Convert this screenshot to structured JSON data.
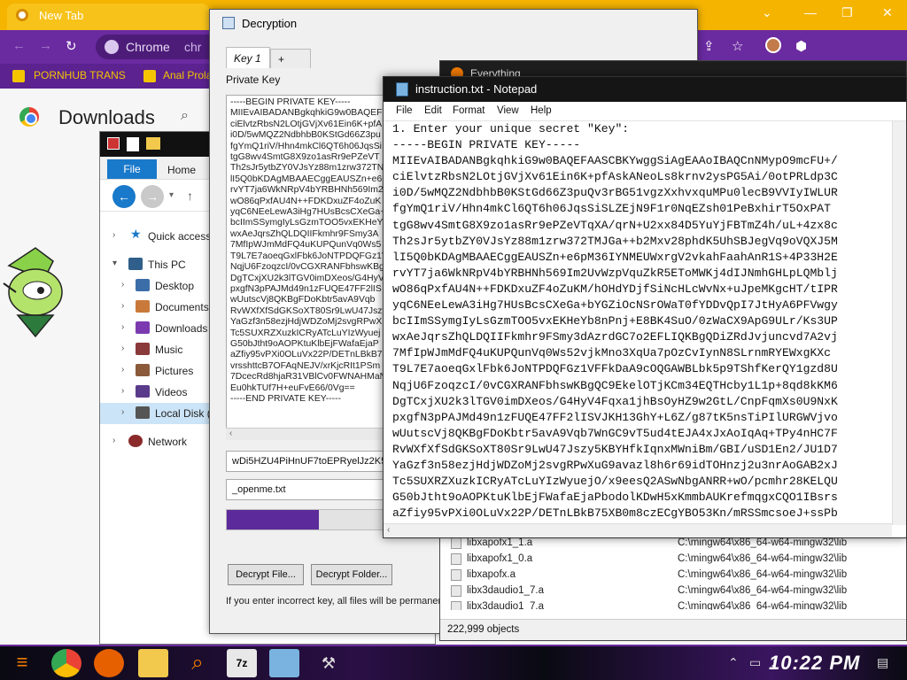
{
  "chrome": {
    "tab_title": "New Tab",
    "omnibox_text": "Chrome",
    "omnibox_suffix": "chr",
    "bookmarks": [
      "PORNHUB TRANS",
      "Anal Prola"
    ],
    "page_title": "Downloads"
  },
  "explorer": {
    "ribbon": {
      "file": "File",
      "home": "Home"
    },
    "tree": [
      {
        "label": "Quick access",
        "icon": "star-icon"
      },
      {
        "label": "This PC",
        "icon": "computer-icon"
      },
      {
        "label": "Desktop",
        "icon": "folder-icon"
      },
      {
        "label": "Documents",
        "icon": "folder-icon"
      },
      {
        "label": "Downloads",
        "icon": "download-folder-icon"
      },
      {
        "label": "Music",
        "icon": "music-folder-icon"
      },
      {
        "label": "Pictures",
        "icon": "pictures-folder-icon"
      },
      {
        "label": "Videos",
        "icon": "videos-folder-icon"
      },
      {
        "label": "Local Disk (",
        "icon": "disk-icon"
      },
      {
        "label": "Network",
        "icon": "network-icon"
      }
    ]
  },
  "decryption": {
    "title": "Decryption",
    "tabs": [
      "Key 1",
      "+"
    ],
    "private_key_label": "Private Key",
    "key_text_lines": [
      "-----BEGIN PRIVATE KEY-----",
      "MIIEvAIBADANBgkqhkiG9w0BAQEF",
      "ciElvtzRbsN2LOtjGVjXv61Ein6K+pfA",
      "i0D/5wMQZ2NdbhbB0KStGd66Z3pu",
      "fgYmQ1riV/Hhn4mkCl6QT6h06JqsSi",
      "tgG8wv4SmtG8X9zo1asRr9ePZeVT",
      "Th2sJr5ytbZY0VJsYz88m1zrw372TN",
      "lI5Q0bKDAgMBAAECggEAUSZn+e6p",
      "rvYT7ja6WkNRpV4bYRBHNh569Im2",
      "wO86qPxfAU4N++FDKDxuZF4oZuK",
      "yqC6NEeLewA3iHg7HUsBcsCXeGa+",
      "bcIImSSymgIyLsGzmTOO5vxEKHeY",
      "wxAeJqrsZhQLDQIIFkmhr9FSmy3A",
      "7MfIpWJmMdFQ4uKUPQunVq0Ws5",
      "T9L7E7aoeqGxlFbk6JoNTPDQFGz1V",
      "NqjU6FzoqzcI/0vCGXRANFbhswKBg",
      "DgTCxjXU2k3lTGV0imDXeos/G4HyV",
      "pxgfN3pPAJMd49n1zFUQE47FF2lIS",
      "wUutscVj8QKBgFDoKbtr5avA9Vqb",
      "RvWXfXfSdGKSoXT80Sr9LwU47Jszy",
      "YaGzf3n58ezjHdjWDZoMj2svgRPwX",
      "Tc5SUXRZXuzkICRyATcLuYIzWyuej",
      "G50bJtht9oAOPKtuKlbEjFWafaEjaP",
      "aZfiy95vPXi0OLuVx22P/DETnLBkB75",
      "vrsshttcB7OFAqNEJV/xrKjcRIt1PSm",
      "7DcecRd8hjaR31VBlCv0FWNAHMaN",
      "Eu0hkTUf7H+euFvE66/0Vg==",
      "-----END PRIVATE KEY-----"
    ],
    "key_input_value": "wDi5HZU4PiHnUF7toEPRyelJz2K5gq",
    "extension_input_value": "_openme.txt",
    "progress_fraction": 0.5,
    "btn_decrypt_file": "Decrypt File...",
    "btn_decrypt_folder": "Decrypt Folder...",
    "warning": "If you enter incorrect key, all files will be permaner"
  },
  "filewin": {
    "title": "Everything",
    "rows": [
      {
        "name": "libxapofx1_1.a",
        "path": "C:\\mingw64\\x86_64-w64-mingw32\\lib"
      },
      {
        "name": "libxapofx1_0.a",
        "path": "C:\\mingw64\\x86_64-w64-mingw32\\lib"
      },
      {
        "name": "libxapofx.a",
        "path": "C:\\mingw64\\x86_64-w64-mingw32\\lib"
      },
      {
        "name": "libx3daudio1_7.a",
        "path": "C:\\mingw64\\x86_64-w64-mingw32\\lib"
      },
      {
        "name": "libx3daudio1_7.a",
        "path": "C:\\mingw64\\x86_64-w64-mingw32\\lib"
      }
    ],
    "status": "222,999 objects"
  },
  "notepad": {
    "title": "instruction.txt - Notepad",
    "menu": [
      "File",
      "Edit",
      "Format",
      "View",
      "Help"
    ],
    "lines": [
      "1. Enter your unique secret \"Key\":",
      "-----BEGIN PRIVATE KEY-----",
      "MIIEvAIBADANBgkqhkiG9w0BAQEFAASCBKYwggSiAgEAAoIBAQCnNMypO9mcFU+/",
      "ciElvtzRbsN2LOtjGVjXv61Ein6K+pfAskANeoLs8krnv2ysPG5Ai/0otPRLdp3C",
      "i0D/5wMQZ2NdbhbB0KStGd66Z3puQv3rBG51vgzXxhvxquMPu0lecB9VVIyIWLUR",
      "fgYmQ1riV/Hhn4mkCl6QT6h06JqsSiSLZEjN9F1r0NqEZsh01PeBxhirT5OxPAT",
      "tgG8wv4SmtG8X9zo1asRr9ePZeVTqXA/qrN+U2xx84D5YuYjFBTmZ4h/uL+4zx8c",
      "Th2sJr5ytbZY0VJsYz88m1zrw372TMJGa++b2Mxv28phdK5UhSBJegVq9oVQXJ5M",
      "lI5Q0bKDAgMBAAECggEAUSZn+e6pM36IYNMEUWxrgV2vkahFaahAnR1S+4P33H2E",
      "rvYT7ja6WkNRpV4bYRBHNh569Im2UvWzpVquZkR5EToMWKj4dIJNmhGHLpLQMblj",
      "wO86qPxfAU4N++FDKDxuZF4oZuKM/hOHdYDjfSiNcHLcWvNx+uJpeMKgcHT/tIPR",
      "yqC6NEeLewA3iHg7HUsBcsCXeGa+bYGZiOcNSrOWaT0fYDDvQpI7JtHyA6PFVwgy",
      "bcIImSSymgIyLsGzmTOO5vxEKHeYb8nPnj+E8BK4SuO/0zWaCX9ApG9ULr/Ks3UP",
      "wxAeJqrsZhQLDQIIFkmhr9FSmy3dAzrdGC7o2EFLIQKBgQDiZRdJvjuncvd7A2vj",
      "7MfIpWJmMdFQ4uKUPQunVq0Ws52vjkMno3XqUa7pOzCvIynN8SLrnmRYEWxgKXc",
      "T9L7E7aoeqGxlFbk6JoNTPDQFGz1VFFkDaA9cOQGAWBLbk5p9TShfKerQY1gzd8U",
      "NqjU6FzoqzcI/0vCGXRANFbhswKBgQC9EkelOTjKCm34EQTHcby1L1p+8qd8kKM6",
      "DgTCxjXU2k3lTGV0imDXeos/G4HyV4Fqxa1jhBsOyHZ9w2GtL/CnpFqmXs0U9NxK",
      "pxgfN3pPAJMd49n1zFUQE47FF2lISVJKH13GhY+L6Z/g87tK5nsTiPIlURGWVjvo",
      "wUutscVj8QKBgFDoKbtr5avA9Vqb7WnGC9vT5ud4tEJA4xJxAoIqAq+TPy4nHC7F",
      "RvWXfXfSdGKSoXT80Sr9LwU47Jszy5KBYHfkIqnxMWniBm/GBI/uSD1En2/JU1D7",
      "YaGzf3n58ezjHdjWDZoMj2svgRPwXuG9avazl8h6r69idTOHnzj2u3nrAoGAB2xJ",
      "Tc5SUXRZXuzkICRyATcLuYIzWyuejO/x9eesQ2ASwNbgANRR+wO/pcmhr28KELQU",
      "G50bJtht9oAOPKtuKlbEjFWafaEjaPbodolKDwH5xKmmbAUKrefmqgxCQO1IBsrs",
      "aZfiy95vPXi0OLuVx22P/DETnLBkB75XB0m8czECgYBO53Kn/mRSSmcsoeJ+ssPb"
    ]
  },
  "taskbar": {
    "clock": "10:22 PM"
  }
}
